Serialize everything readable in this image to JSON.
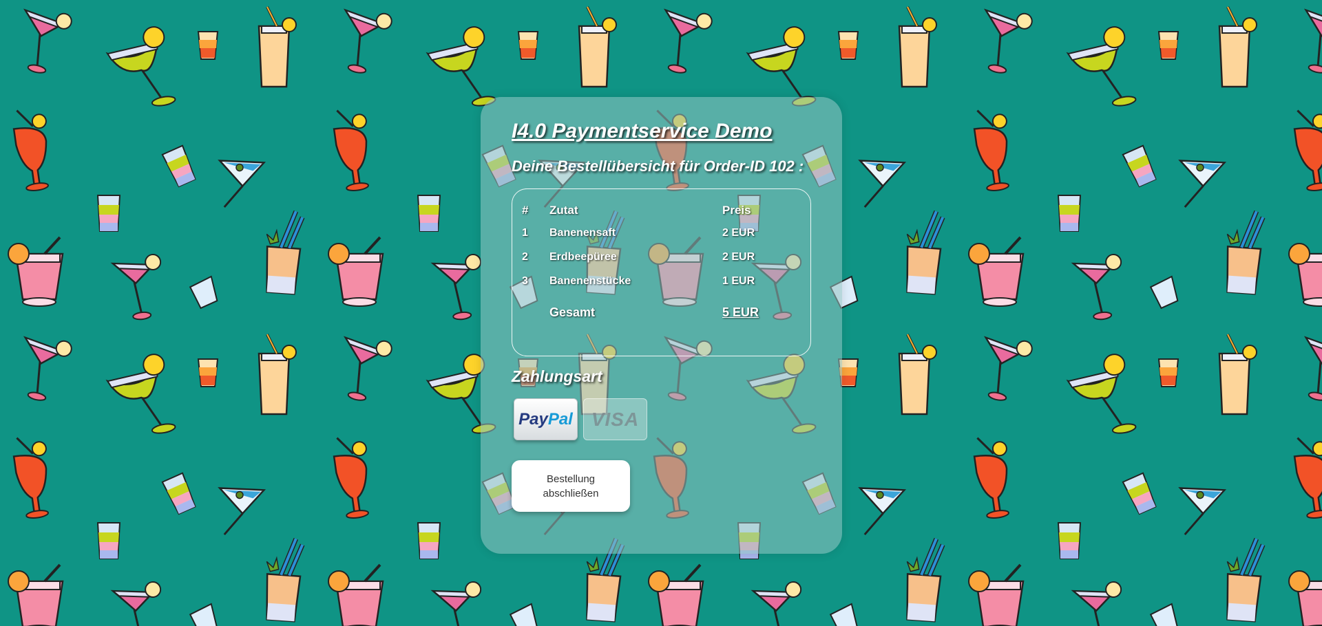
{
  "page": {
    "title": "I4.0 Paymentservice Demo",
    "subtitle": "Deine Bestellübersicht für Order-ID 102 :"
  },
  "order": {
    "headers": {
      "num": "#",
      "ingredient": "Zutat",
      "price": "Preis"
    },
    "items": [
      {
        "num": "1",
        "ingredient": "Banenensaft",
        "price": "2 EUR"
      },
      {
        "num": "2",
        "ingredient": "Erdbeepüree",
        "price": "2 EUR"
      },
      {
        "num": "3",
        "ingredient": "Banenenstücke",
        "price": "1 EUR"
      }
    ],
    "total_label": "Gesamt",
    "total_value": "5 EUR"
  },
  "payment": {
    "heading": "Zahlungsart",
    "paypal_part1": "Pay",
    "paypal_part2": "Pal",
    "visa_label": "VISA"
  },
  "actions": {
    "complete_label": "Bestellung abschließen"
  },
  "colors": {
    "background": "#0f9485",
    "paypal_dark": "#253b80",
    "paypal_light": "#179bd7"
  }
}
